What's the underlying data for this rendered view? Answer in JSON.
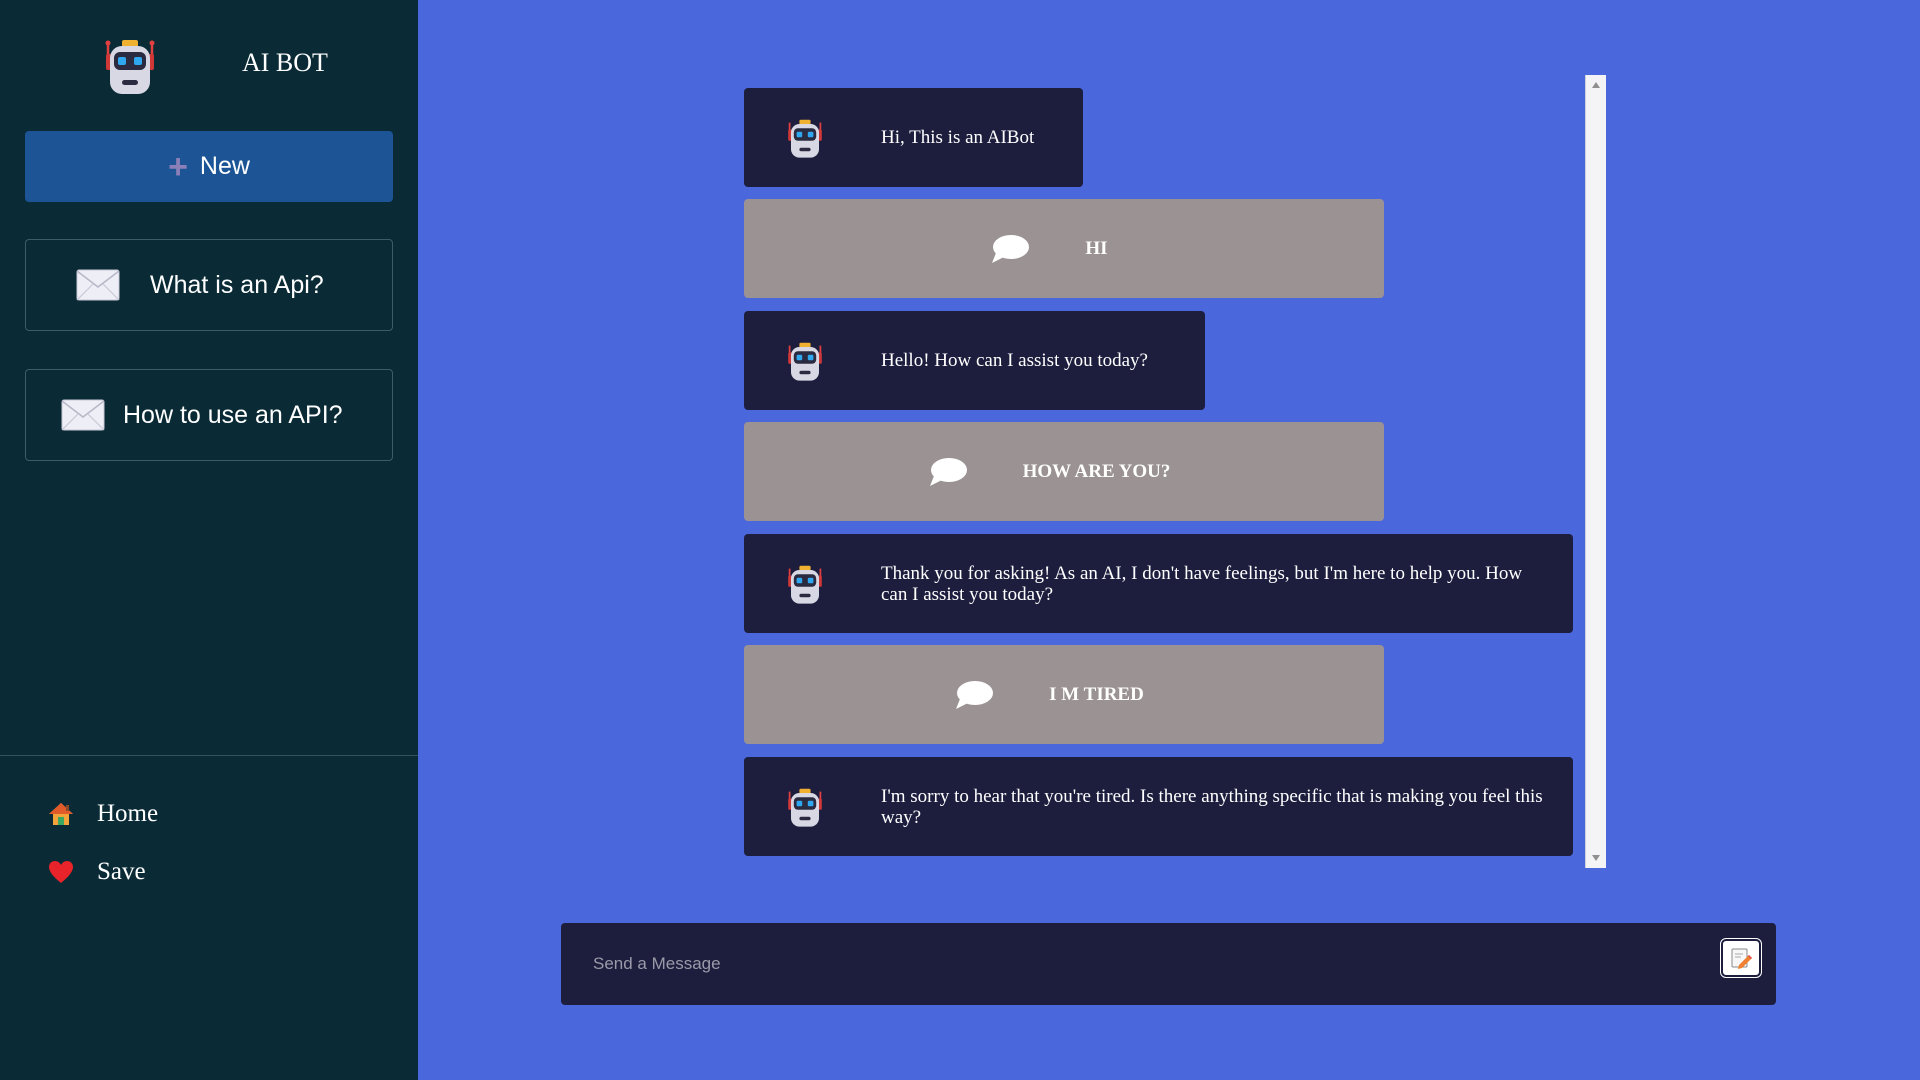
{
  "app": {
    "title": "AI BOT",
    "logo_icon": "robot-icon"
  },
  "sidebar": {
    "new_label": "New",
    "history": [
      {
        "label": "What is an Api?",
        "icon": "mail-icon"
      },
      {
        "label": "How to use an API?",
        "icon": "mail-icon"
      }
    ],
    "nav": [
      {
        "label": "Home",
        "icon": "home-icon"
      },
      {
        "label": "Save",
        "icon": "heart-icon"
      }
    ]
  },
  "chat": {
    "messages": [
      {
        "role": "bot",
        "text": "Hi, This is an AIBot"
      },
      {
        "role": "user",
        "text": "HI"
      },
      {
        "role": "bot",
        "text": "Hello! How can I assist you today?"
      },
      {
        "role": "user",
        "text": "HOW ARE YOU?"
      },
      {
        "role": "bot",
        "text": "Thank you for asking! As an AI, I don't have feelings, but I'm here to help you. How can I assist you today?"
      },
      {
        "role": "user",
        "text": "I M TIRED"
      },
      {
        "role": "bot",
        "text": "I'm sorry to hear that you're tired. Is there anything specific that is making you feel this way?"
      }
    ]
  },
  "composer": {
    "placeholder": "Send a Message",
    "send_icon": "edit-icon"
  },
  "colors": {
    "background": "#4a67dc",
    "sidebar": "#0a2b36",
    "new_button": "#1c5496",
    "bot_bubble": "#1d1e3e",
    "user_bubble": "#9b9393"
  }
}
